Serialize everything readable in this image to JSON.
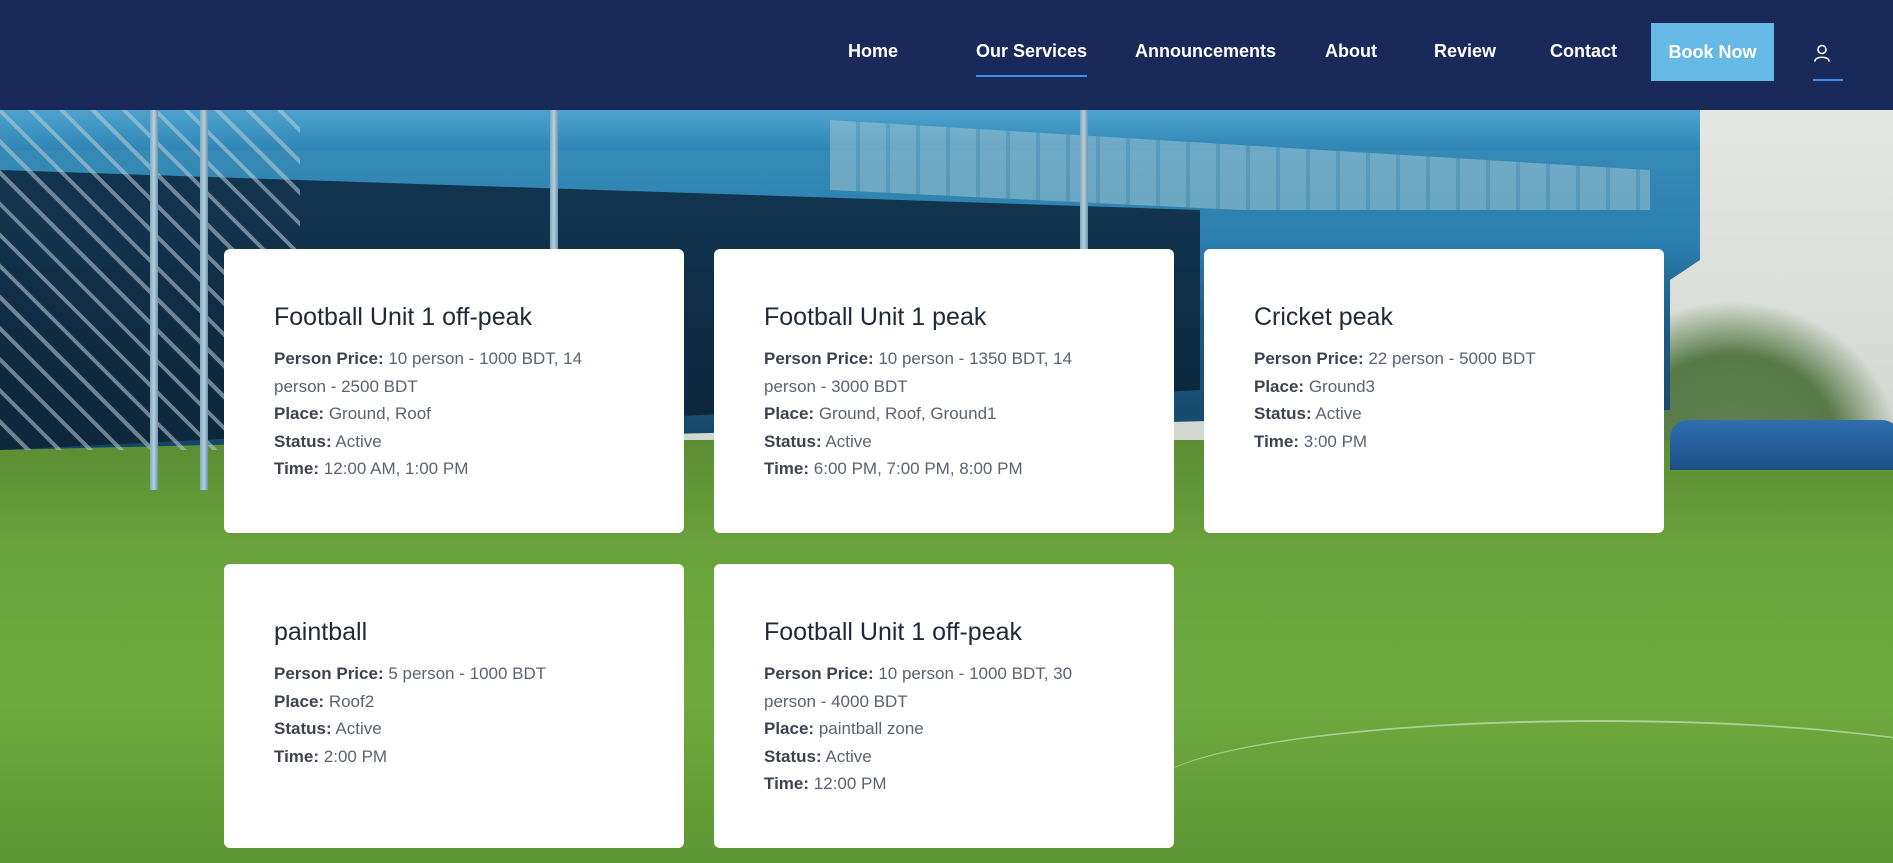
{
  "nav": {
    "items": [
      {
        "label": "Home",
        "active": false
      },
      {
        "label": "Our Services",
        "active": true
      },
      {
        "label": "Announcements",
        "active": false
      },
      {
        "label": "About",
        "active": false
      },
      {
        "label": "Review",
        "active": false
      },
      {
        "label": "Contact",
        "active": false
      }
    ],
    "book_now": "Book Now",
    "user_icon": "user-icon"
  },
  "labels": {
    "price": "Person Price:",
    "place": "Place:",
    "status": "Status:",
    "time": "Time:"
  },
  "services": [
    {
      "title": "Football Unit 1 off-peak",
      "price": "10 person - 1000 BDT, 14 person - 2500 BDT",
      "place": "Ground, Roof",
      "status": "Active",
      "time": "12:00 AM, 1:00 PM"
    },
    {
      "title": "Football Unit 1 peak",
      "price": "10 person - 1350 BDT, 14 person - 3000 BDT",
      "place": "Ground, Roof, Ground1",
      "status": "Active",
      "time": "6:00 PM, 7:00 PM, 8:00 PM"
    },
    {
      "title": "Cricket peak",
      "price": "22 person - 5000 BDT",
      "place": "Ground3",
      "status": "Active",
      "time": "3:00 PM"
    },
    {
      "title": "paintball",
      "price": "5 person - 1000 BDT",
      "place": "Roof2",
      "status": "Active",
      "time": "2:00 PM"
    },
    {
      "title": "Football Unit 1 off-peak",
      "price": "10 person - 1000 BDT, 30 person - 4000 BDT",
      "place": "paintball zone",
      "status": "Active",
      "time": "12:00 PM"
    }
  ],
  "colors": {
    "navbar": "#19295a",
    "accent": "#67b9e5",
    "underline": "#3d8ef3"
  }
}
